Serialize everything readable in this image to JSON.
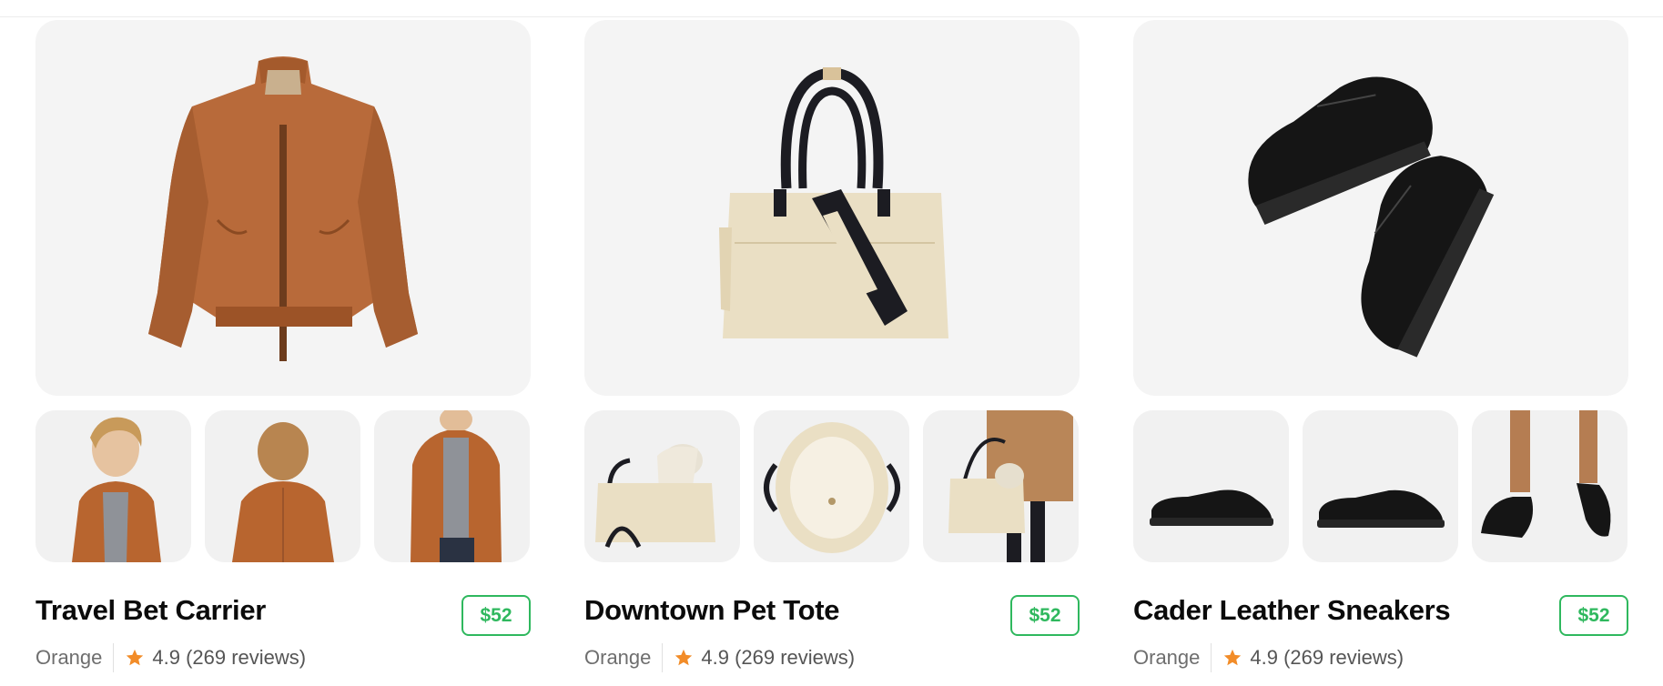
{
  "products": [
    {
      "title": "Travel Bet Carrier",
      "price": "$52",
      "color": "Orange",
      "rating": "4.9 (269 reviews)",
      "hero_icon": "suede-jacket",
      "thumbs": [
        "model-wearing-jacket-front",
        "model-wearing-jacket-back",
        "model-wearing-jacket-open"
      ]
    },
    {
      "title": "Downtown Pet Tote",
      "price": "$52",
      "color": "Orange",
      "rating": "4.9 (269 reviews)",
      "hero_icon": "canvas-tote-bag",
      "thumbs": [
        "dog-in-tote",
        "tote-interior",
        "person-carrying-tote-with-dog"
      ]
    },
    {
      "title": "Cader Leather Sneakers",
      "price": "$52",
      "color": "Orange",
      "rating": "4.9 (269 reviews)",
      "hero_icon": "black-leather-sneakers",
      "thumbs": [
        "sneaker-side",
        "sneaker-side-alt",
        "person-wearing-sneakers"
      ]
    }
  ],
  "colors": {
    "price_green": "#2fb85e",
    "star_orange": "#f28c28",
    "card_bg": "#f4f4f4"
  }
}
